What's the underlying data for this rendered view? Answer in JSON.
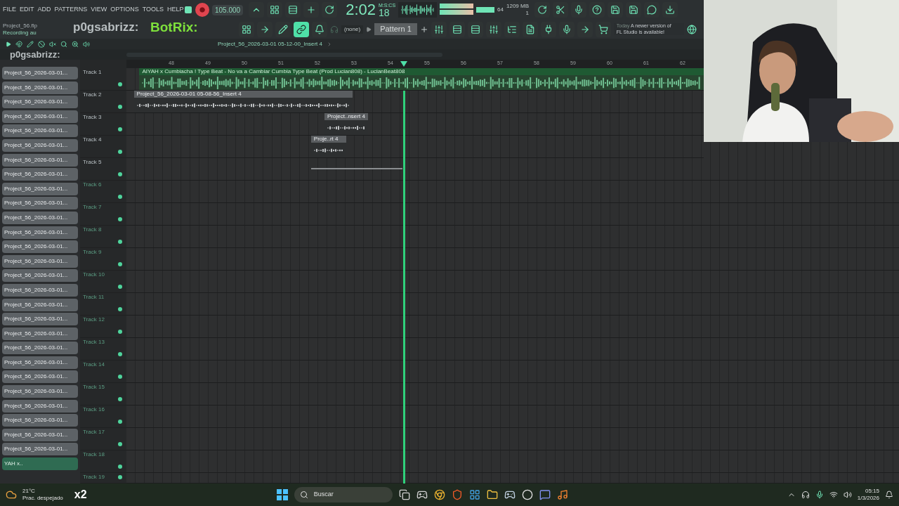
{
  "menu": [
    "FILE",
    "EDIT",
    "ADD",
    "PATTERNS",
    "VIEW",
    "OPTIONS",
    "TOOLS",
    "HELP"
  ],
  "transport": {
    "tempo": "105.000",
    "time": "2:02",
    "time_cs": "18",
    "time_unit": "M:S:CS",
    "cpu": "64",
    "memory": "1209 MB",
    "polyphony": "1",
    "recording": true
  },
  "hint": {
    "file": "Project_56.flp",
    "status": "Recording au"
  },
  "pattern": {
    "channel": "(none)",
    "name": "Pattern 1"
  },
  "news": {
    "when": "Today",
    "message_1": "A newer version of",
    "message_2": "FL Studio is available!"
  },
  "breadcrumb": "Project_56_2026-03-01 05-12-00_Insert 4",
  "overlay": {
    "chat_1": "p0gsabrizz:",
    "chat_2": "BotRix:",
    "chat_3": "p0gsabrizz:",
    "badge": "x2"
  },
  "ruler": [
    "48",
    "49",
    "50",
    "51",
    "52",
    "53",
    "54",
    "55",
    "56",
    "57",
    "58",
    "59",
    "60",
    "61",
    "62"
  ],
  "channels": [
    {
      "name": "Project_56_2026-03-01...",
      "selected": false
    },
    {
      "name": "Project_56_2026-03-01...",
      "selected": false
    },
    {
      "name": "Project_56_2026-03-01...",
      "selected": false
    },
    {
      "name": "Project_56_2026-03-01...",
      "selected": false
    },
    {
      "name": "Project_56_2026-03-01...",
      "selected": false
    },
    {
      "name": "Project_56_2026-03-01...",
      "selected": false
    },
    {
      "name": "Project_56_2026-03-01...",
      "selected": false
    },
    {
      "name": "Project_56_2026-03-01...",
      "selected": false
    },
    {
      "name": "Project_56_2026-03-01...",
      "selected": false
    },
    {
      "name": "Project_56_2026-03-01...",
      "selected": false
    },
    {
      "name": "Project_56_2026-03-01...",
      "selected": false
    },
    {
      "name": "Project_56_2026-03-01...",
      "selected": false
    },
    {
      "name": "Project_56_2026-03-01...",
      "selected": false
    },
    {
      "name": "Project_56_2026-03-01...",
      "selected": false
    },
    {
      "name": "Project_56_2026-03-01...",
      "selected": false
    },
    {
      "name": "Project_56_2026-03-01...",
      "selected": false
    },
    {
      "name": "Project_56_2026-03-01...",
      "selected": false
    },
    {
      "name": "Project_56_2026-03-01...",
      "selected": false
    },
    {
      "name": "Project_56_2026-03-01...",
      "selected": false
    },
    {
      "name": "Project_56_2026-03-01...",
      "selected": false
    },
    {
      "name": "Project_56_2026-03-01...",
      "selected": false
    },
    {
      "name": "Project_56_2026-03-01...",
      "selected": false
    },
    {
      "name": "Project_56_2026-03-01...",
      "selected": false
    },
    {
      "name": "Project_56_2026-03-01...",
      "selected": false
    },
    {
      "name": "Project_56_2026-03-01...",
      "selected": false
    },
    {
      "name": "Project_56_2026-03-01...",
      "selected": false
    },
    {
      "name": "Project_56_2026-03-01...",
      "selected": false
    },
    {
      "name": "YAH x..",
      "selected": true
    }
  ],
  "tracks": [
    {
      "name": "Track 1",
      "active": true,
      "clips": [
        {
          "kind": "audio",
          "label": "AIYAH x Cumbiacha ! Type Beat - No va a Cambiar  Cumbia Type Beat (Prod Lucian808) - LucianBeat808"
        }
      ]
    },
    {
      "name": "Track 2",
      "active": true,
      "clips": [
        {
          "kind": "audio",
          "label": "Project_56_2026-03-01 05-08-56_Insert 4"
        }
      ]
    },
    {
      "name": "Track 3",
      "active": true,
      "clips": [
        {
          "kind": "audio",
          "label": "Project..nsert 4"
        }
      ]
    },
    {
      "name": "Track 4",
      "active": true,
      "clips": [
        {
          "kind": "audio",
          "label": "Proje..rt 4"
        }
      ]
    },
    {
      "name": "Track 5",
      "active": true,
      "clips": [
        {
          "kind": "take"
        }
      ]
    },
    {
      "name": "Track 6",
      "active": false
    },
    {
      "name": "Track 7",
      "active": false
    },
    {
      "name": "Track 8",
      "active": false
    },
    {
      "name": "Track 9",
      "active": false
    },
    {
      "name": "Track 10",
      "active": false
    },
    {
      "name": "Track 11",
      "active": false
    },
    {
      "name": "Track 12",
      "active": false
    },
    {
      "name": "Track 13",
      "active": false
    },
    {
      "name": "Track 14",
      "active": false
    },
    {
      "name": "Track 15",
      "active": false
    },
    {
      "name": "Track 16",
      "active": false
    },
    {
      "name": "Track 17",
      "active": false
    },
    {
      "name": "Track 18",
      "active": false
    },
    {
      "name": "Track 19",
      "active": false
    }
  ],
  "taskbar": {
    "temperature": "21°C",
    "weather": "Prac. despejado",
    "search": "Buscar",
    "time": "05:15",
    "date": "1/3/2026"
  }
}
